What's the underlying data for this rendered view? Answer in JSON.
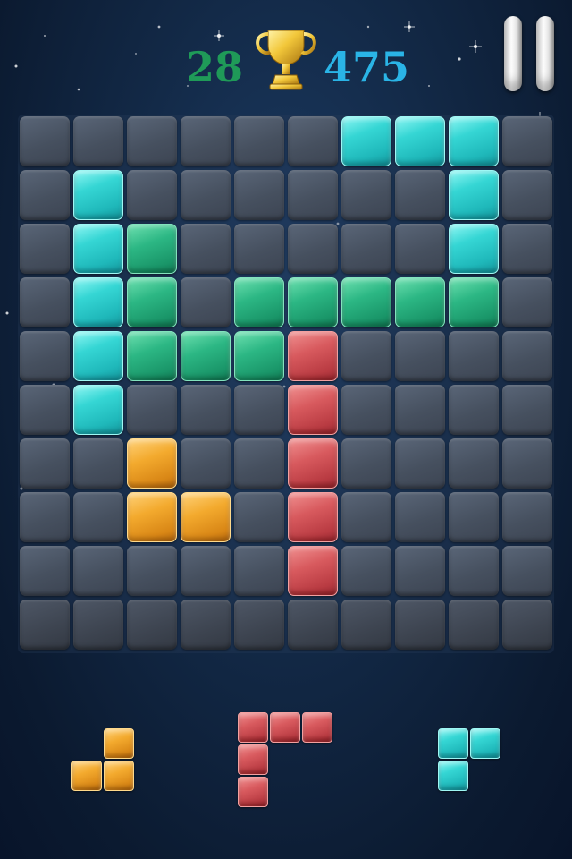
{
  "hud": {
    "current_score": "28",
    "best_score": "475",
    "current_color": "#1f9a58",
    "best_color": "#2ab4e6",
    "trophy_icon": "trophy-icon",
    "pause_icon": "pause-icon"
  },
  "board": {
    "rows": 10,
    "cols": 10,
    "cells": [
      [
        "E",
        "E",
        "E",
        "E",
        "E",
        "E",
        "C",
        "C",
        "C",
        "E"
      ],
      [
        "E",
        "C",
        "E",
        "E",
        "E",
        "E",
        "E",
        "E",
        "C",
        "E"
      ],
      [
        "E",
        "C",
        "G",
        "E",
        "E",
        "E",
        "E",
        "E",
        "C",
        "E"
      ],
      [
        "E",
        "C",
        "G",
        "E",
        "G",
        "G",
        "G",
        "G",
        "G",
        "E"
      ],
      [
        "E",
        "C",
        "G",
        "G",
        "G",
        "R",
        "E",
        "E",
        "E",
        "E"
      ],
      [
        "E",
        "C",
        "E",
        "E",
        "E",
        "R",
        "E",
        "E",
        "E",
        "E"
      ],
      [
        "E",
        "E",
        "O",
        "E",
        "E",
        "R",
        "E",
        "E",
        "E",
        "E"
      ],
      [
        "E",
        "E",
        "O",
        "O",
        "E",
        "R",
        "E",
        "E",
        "E",
        "E"
      ],
      [
        "E",
        "E",
        "E",
        "E",
        "E",
        "R",
        "E",
        "E",
        "E",
        "E"
      ],
      [
        "E",
        "E",
        "E",
        "E",
        "E",
        "E",
        "E",
        "E",
        "E",
        "E"
      ]
    ],
    "legend": {
      "E": "empty",
      "C": "cyan",
      "G": "green",
      "R": "red",
      "O": "orange"
    }
  },
  "tray": {
    "pieces": [
      {
        "name": "piece-orange",
        "color": "orange",
        "cells": [
          [
            1,
            0
          ],
          [
            0,
            1
          ],
          [
            1,
            1
          ]
        ]
      },
      {
        "name": "piece-red",
        "color": "red",
        "cells": [
          [
            0,
            0
          ],
          [
            1,
            0
          ],
          [
            2,
            0
          ],
          [
            0,
            1
          ],
          [
            0,
            2
          ]
        ]
      },
      {
        "name": "piece-cyan",
        "color": "cyan",
        "cells": [
          [
            0,
            0
          ],
          [
            1,
            0
          ],
          [
            0,
            1
          ]
        ]
      }
    ]
  }
}
